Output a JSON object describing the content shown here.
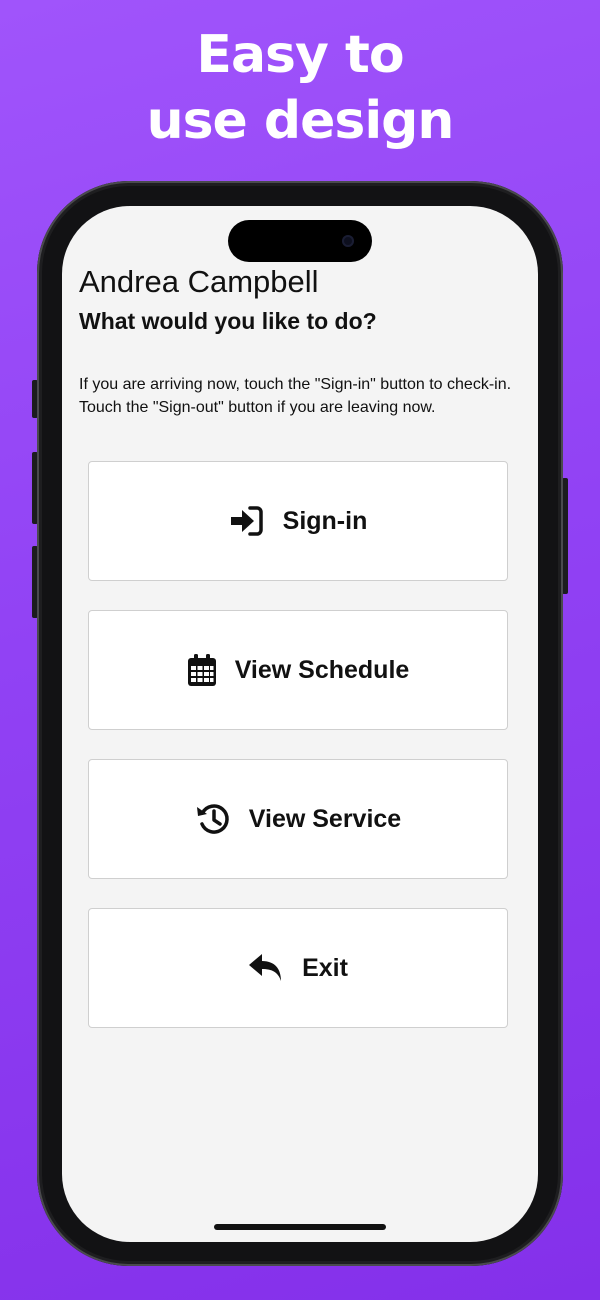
{
  "promo": {
    "headline_line1": "Easy to",
    "headline_line2": "use design"
  },
  "screen": {
    "user_name": "Andrea Campbell",
    "prompt": "What would you like to do?",
    "instructions": "If you are arriving now, touch the \"Sign-in\" button to check-in. Touch the \"Sign-out\" button if you are leaving now."
  },
  "actions": [
    {
      "label": "Sign-in",
      "icon": "sign-in-icon"
    },
    {
      "label": "View Schedule",
      "icon": "calendar-icon"
    },
    {
      "label": "View Service",
      "icon": "history-icon"
    },
    {
      "label": "Exit",
      "icon": "reply-arrow-icon"
    }
  ],
  "colors": {
    "background_top": "#a054fb",
    "background_bottom": "#8430ea",
    "screen_background": "#f4f4f4",
    "button_background": "#ffffff",
    "button_border": "#cfcfcf",
    "text": "#111111"
  }
}
